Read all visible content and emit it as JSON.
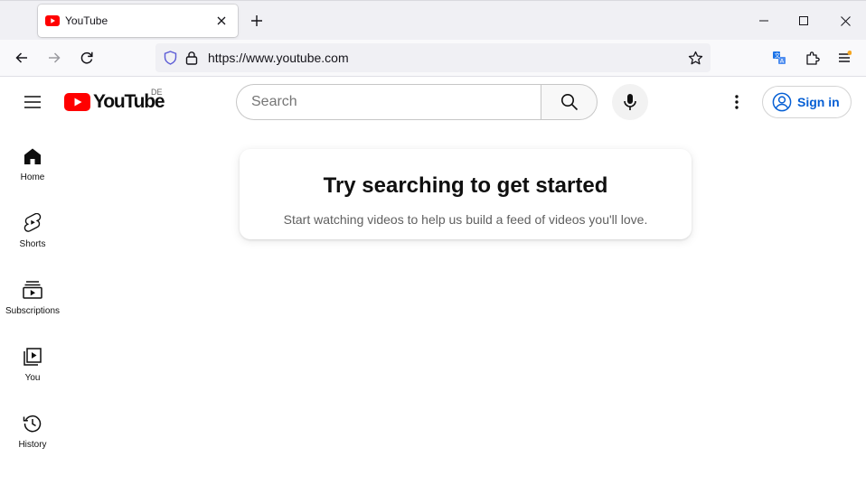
{
  "browser": {
    "tab": {
      "title": "YouTube",
      "favicon": "youtube-favicon-icon"
    },
    "new_tab_icon": "plus-icon",
    "window_controls": [
      "minimize-icon",
      "maximize-icon",
      "close-icon"
    ],
    "url": "https://www.youtube.com",
    "toolbar_icons": [
      "back-arrow-icon",
      "forward-arrow-icon",
      "reload-icon",
      "shield-icon",
      "lock-icon",
      "star-icon",
      "translate-icon",
      "extensions-icon",
      "menu-icon"
    ]
  },
  "youtube": {
    "logo_text": "YouTube",
    "country_code": "DE",
    "search": {
      "placeholder": "Search"
    },
    "sign_in_label": "Sign in",
    "sidebar": [
      {
        "label": "Home",
        "icon": "home-icon"
      },
      {
        "label": "Shorts",
        "icon": "shorts-icon"
      },
      {
        "label": "Subscriptions",
        "icon": "subscriptions-icon"
      },
      {
        "label": "You",
        "icon": "you-library-icon"
      },
      {
        "label": "History",
        "icon": "history-icon"
      }
    ],
    "empty_state": {
      "title": "Try searching to get started",
      "subtitle": "Start watching videos to help us build a feed of videos you'll love."
    }
  },
  "colors": {
    "youtube_red": "#ff0000",
    "link_blue": "#065fd4",
    "tab_strip": "#f0f0f4",
    "url_bar": "#f0f0f4"
  }
}
